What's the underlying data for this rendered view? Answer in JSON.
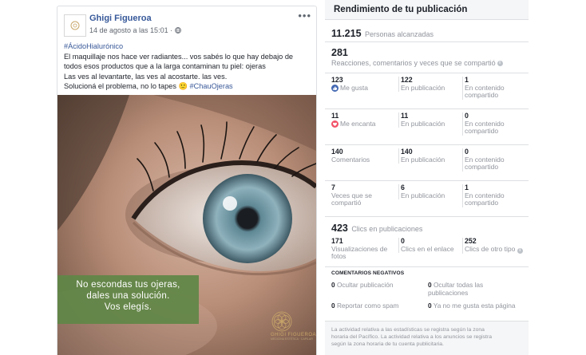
{
  "post": {
    "author": "Ghigi Figueroa",
    "timestamp": "14 de agosto a las 15:01 ·",
    "more_label": "•••",
    "text": {
      "hashtag": "#ÁcidoHialurónico",
      "line1": "El maquillaje nos hace ver radiantes... vos sabés lo que hay debajo de",
      "line2": "todos esos productos que a la larga contaminan tu piel: ojeras",
      "line3": "Las ves al levantarte, las ves al acostarte. las ves.",
      "line4_pre": "Solucioná el problema, no lo tapes 🙂 ",
      "line4_tag": "#ChauOjeras"
    },
    "image_caption": {
      "line1": "No escondas tus ojeras,",
      "line2": "dales una solución.",
      "line3": "Vos elegís."
    },
    "brand_logo": {
      "name": "GHIGI FIGUEROA",
      "subtitle": "MEDICINA ESTÉTICA · CAPILAR"
    }
  },
  "insights": {
    "title": "Rendimiento de tu publicación",
    "reach": {
      "value": "11.215",
      "label": "Personas alcanzadas"
    },
    "reactions_total": {
      "value": "281",
      "label": "Reacciones, comentarios y veces que se compartió"
    },
    "rows": [
      {
        "total": "123",
        "total_label": "Me gusta",
        "icon": "like-icon",
        "on_post": "122",
        "on_post_label": "En publicación",
        "shared": "1",
        "shared_label": "En contenido compartido"
      },
      {
        "total": "11",
        "total_label": "Me encanta",
        "icon": "love-icon",
        "on_post": "11",
        "on_post_label": "En publicación",
        "shared": "0",
        "shared_label": "En contenido compartido"
      },
      {
        "total": "140",
        "total_label": "Comentarios",
        "icon": "",
        "on_post": "140",
        "on_post_label": "En publicación",
        "shared": "0",
        "shared_label": "En contenido compartido"
      },
      {
        "total": "7",
        "total_label": "Veces que se compartió",
        "icon": "",
        "on_post": "6",
        "on_post_label": "En publicación",
        "shared": "1",
        "shared_label": "En contenido compartido"
      }
    ],
    "clicks": {
      "value": "423",
      "label": "Clics en publicaciones",
      "items": [
        {
          "value": "171",
          "label": "Visualizaciones de fotos"
        },
        {
          "value": "0",
          "label": "Clics en el enlace"
        },
        {
          "value": "252",
          "label": "Clics de otro tipo"
        }
      ]
    },
    "negative": {
      "header": "COMENTARIOS NEGATIVOS",
      "items": [
        {
          "value": "0",
          "label": "Ocultar publicación"
        },
        {
          "value": "0",
          "label": "Ocultar todas las publicaciones"
        },
        {
          "value": "0",
          "label": "Reportar como spam"
        },
        {
          "value": "0",
          "label": "Ya no me gusta esta página"
        }
      ]
    },
    "footer": {
      "line1": "La actividad relativa a las estadísticas se registra según la zona",
      "line2": "horaria del Pacífico. La actividad relativa a los anuncios se registra",
      "line3": "según la zona horaria de tu cuenta publicitaria."
    }
  }
}
